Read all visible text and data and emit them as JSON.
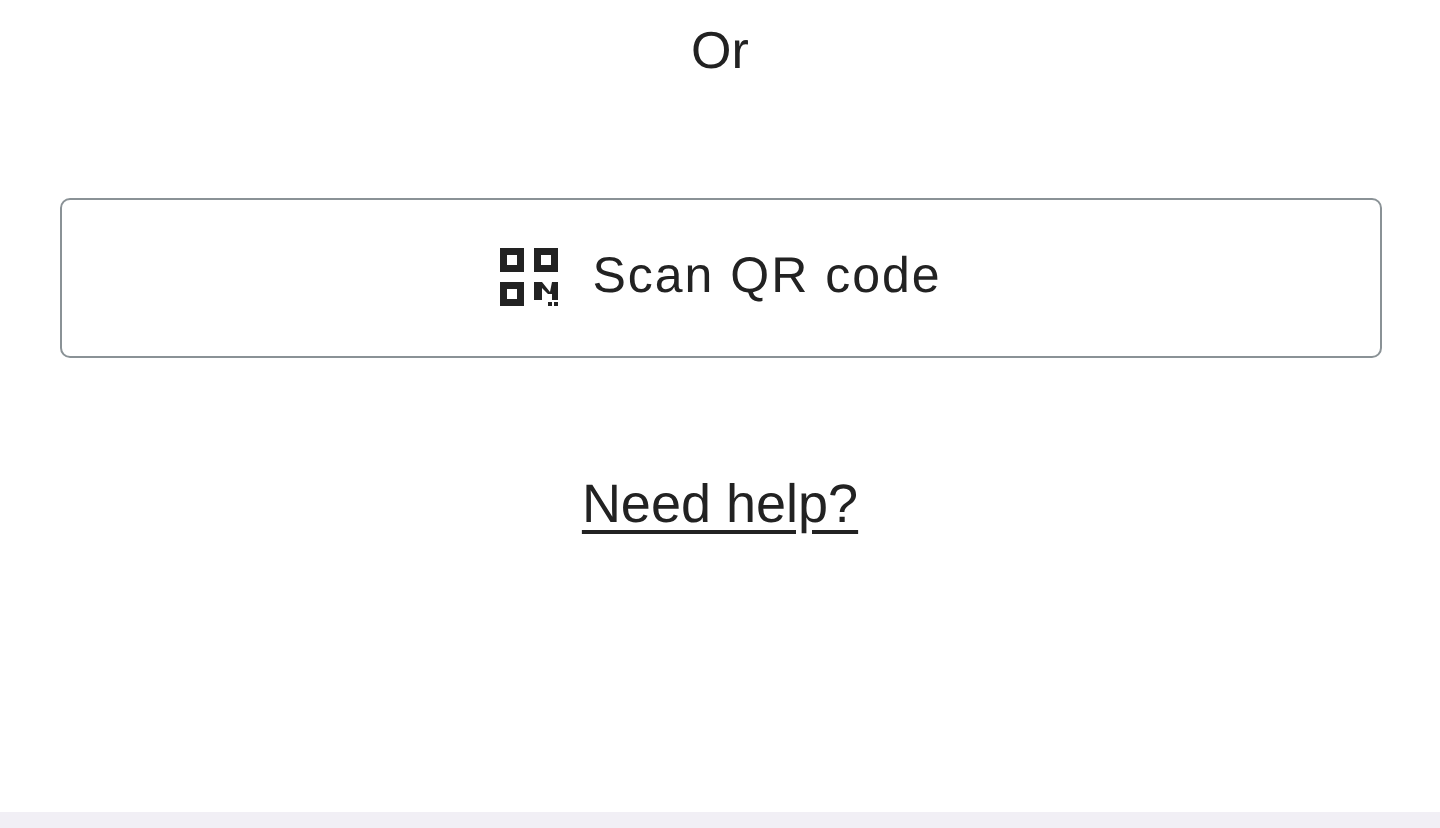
{
  "divider_text": "Or",
  "scan_button": {
    "label": "Scan QR code"
  },
  "help_link": "Need help?"
}
